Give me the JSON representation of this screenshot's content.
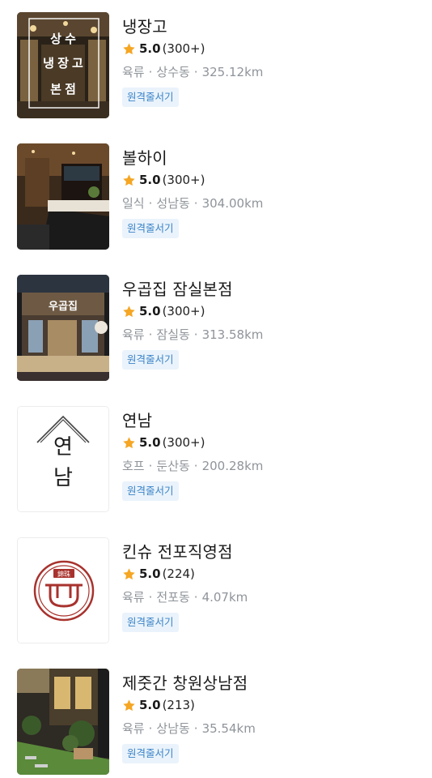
{
  "restaurants": [
    {
      "name": "냉장고",
      "score": "5.0",
      "count": "(300+)",
      "category": "육류",
      "area": "상수동",
      "distance": "325.12km",
      "tag": "원격줄서기",
      "thumb_text": [
        "상 수",
        "냉 장 고",
        "본 점"
      ]
    },
    {
      "name": "볼하이",
      "score": "5.0",
      "count": "(300+)",
      "category": "일식",
      "area": "성남동",
      "distance": "304.00km",
      "tag": "원격줄서기"
    },
    {
      "name": "우곱집 잠실본점",
      "score": "5.0",
      "count": "(300+)",
      "category": "육류",
      "area": "잠실동",
      "distance": "313.58km",
      "tag": "원격줄서기",
      "thumb_text": [
        "우곱집"
      ]
    },
    {
      "name": "연남",
      "score": "5.0",
      "count": "(300+)",
      "category": "호프",
      "area": "둔산동",
      "distance": "200.28km",
      "tag": "원격줄서기",
      "thumb_text": [
        "연",
        "남"
      ]
    },
    {
      "name": "킨슈 전포직영점",
      "score": "5.0",
      "count": "(224)",
      "category": "육류",
      "area": "전포동",
      "distance": "4.07km",
      "tag": "원격줄서기",
      "thumb_text": [
        "錦珠"
      ]
    },
    {
      "name": "제줏간 창원상남점",
      "score": "5.0",
      "count": "(213)",
      "category": "육류",
      "area": "상남동",
      "distance": "35.54km",
      "tag": "원격줄서기"
    }
  ],
  "colors": {
    "star": "#f5a623",
    "tag_bg": "#eaf3fb",
    "tag_text": "#3a83c8",
    "meta": "#8f949a",
    "logo_red": "#a8322d"
  },
  "icons": {
    "rating": "star-icon"
  }
}
